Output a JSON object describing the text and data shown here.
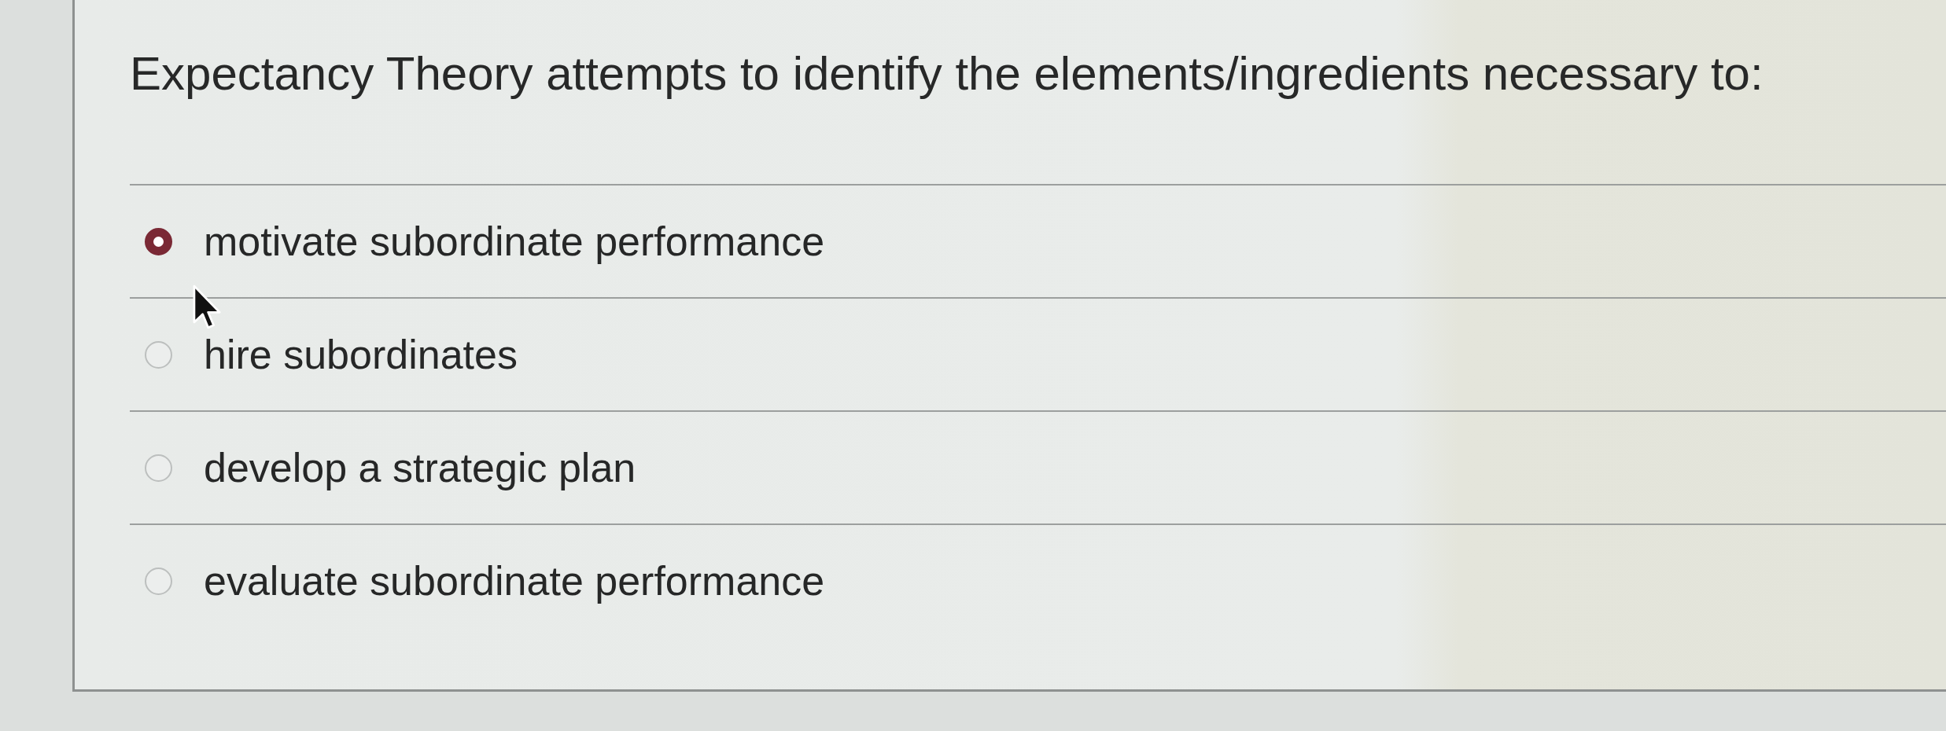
{
  "question": {
    "text": "Expectancy Theory attempts to identify the elements/ingredients necessary to:"
  },
  "options": [
    {
      "label": "motivate subordinate performance",
      "selected": true
    },
    {
      "label": "hire subordinates",
      "selected": false
    },
    {
      "label": "develop a strategic plan",
      "selected": false
    },
    {
      "label": "evaluate subordinate performance",
      "selected": false
    }
  ]
}
